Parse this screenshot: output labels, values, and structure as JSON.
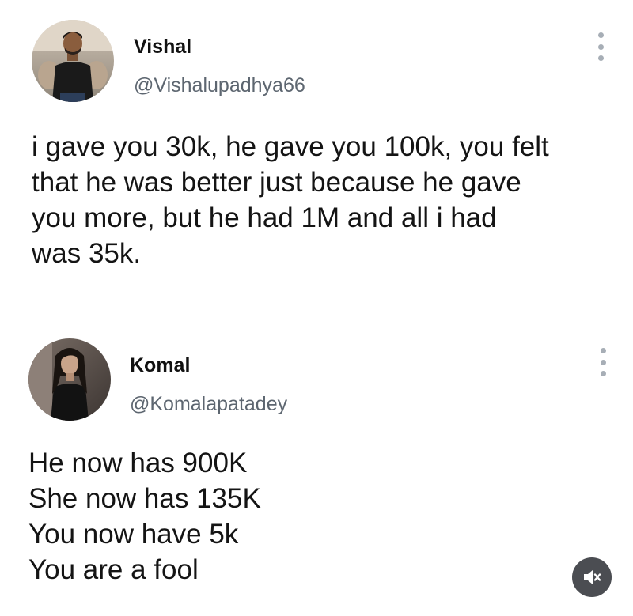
{
  "tweets": [
    {
      "author_name": "Vishal",
      "author_handle": "@Vishalupadhya66",
      "avatar_icon": "male-profile-photo",
      "more_icon": "vertical-ellipsis-icon",
      "lines": [
        "i gave you 30k, he gave you 100k, you felt",
        "that he was better just because he gave",
        "you more, but he had 1M and all i had",
        "was 35k."
      ]
    },
    {
      "author_name": "Komal",
      "author_handle": "@Komalapatadey",
      "avatar_icon": "female-profile-photo",
      "more_icon": "vertical-ellipsis-icon",
      "lines": [
        "He now has 900K",
        "She now has 135K",
        "You now have 5k",
        "You are a fool"
      ]
    }
  ],
  "mute_button": {
    "icon": "muted-speaker-icon"
  },
  "colors": {
    "text": "#141414",
    "handle": "#5d6670",
    "dots": "#a7aeb6",
    "mute_bg": "#4b4d52"
  }
}
